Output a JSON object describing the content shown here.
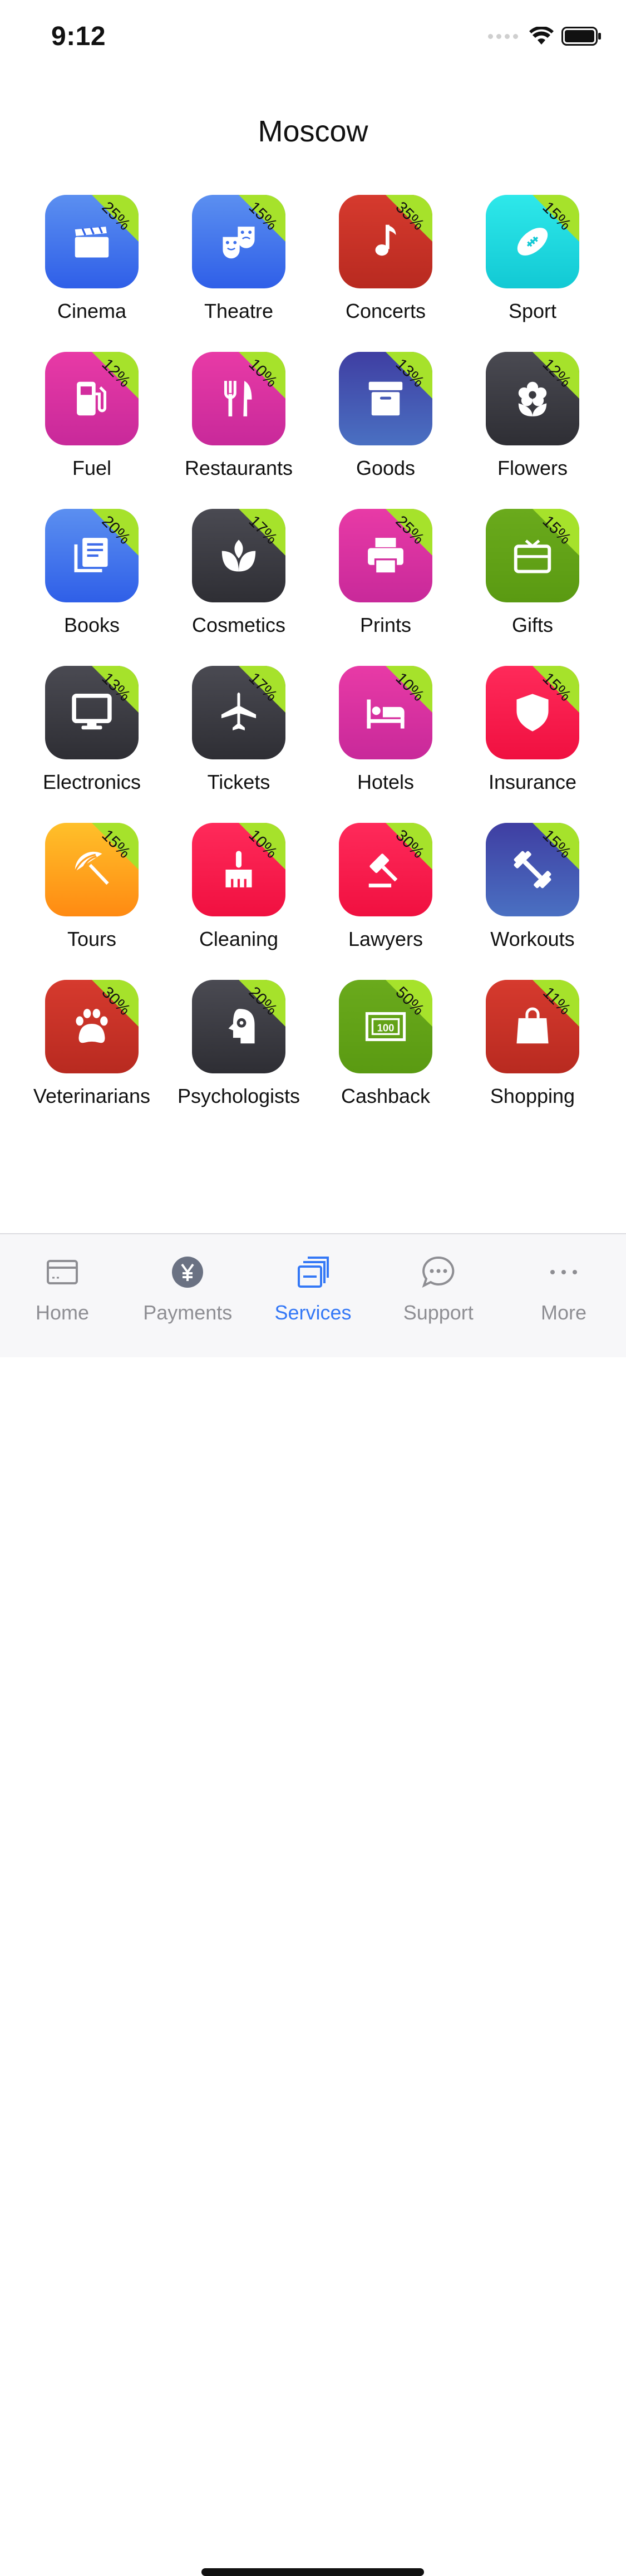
{
  "status": {
    "time": "9:12"
  },
  "page_title": "Moscow",
  "colors": {
    "accent": "#3478f6",
    "badge": "#a6e22b",
    "inactive": "#8e8e93"
  },
  "services": [
    {
      "key": "cinema",
      "label": "Cinema",
      "discount": "25%",
      "icon": "clapperboard-icon",
      "bg": "linear-gradient(180deg,#5b8ff0,#2f5fe8)"
    },
    {
      "key": "theatre",
      "label": "Theatre",
      "discount": "15%",
      "icon": "theatre-masks-icon",
      "bg": "linear-gradient(180deg,#5b8ff0,#2f5fe8)"
    },
    {
      "key": "concerts",
      "label": "Concerts",
      "discount": "35%",
      "icon": "music-note-icon",
      "bg": "linear-gradient(180deg,#d63a2e,#b82a20)"
    },
    {
      "key": "sport",
      "label": "Sport",
      "discount": "15%",
      "icon": "football-icon",
      "bg": "linear-gradient(180deg,#2ee8ea,#12c9d4)"
    },
    {
      "key": "fuel",
      "label": "Fuel",
      "discount": "12%",
      "icon": "fuel-pump-icon",
      "bg": "linear-gradient(180deg,#e83aa6,#c8299a)"
    },
    {
      "key": "restaurants",
      "label": "Restaurants",
      "discount": "10%",
      "icon": "fork-knife-icon",
      "bg": "linear-gradient(180deg,#e83aa6,#c8299a)"
    },
    {
      "key": "goods",
      "label": "Goods",
      "discount": "13%",
      "icon": "box-icon",
      "bg": "linear-gradient(180deg,#3f3ea2,#4a70c2)"
    },
    {
      "key": "flowers",
      "label": "Flowers",
      "discount": "12%",
      "icon": "flower-icon",
      "bg": "linear-gradient(180deg,#4a4a52,#2e2e34)"
    },
    {
      "key": "books",
      "label": "Books",
      "discount": "20%",
      "icon": "book-pages-icon",
      "bg": "linear-gradient(180deg,#5b8ff0,#2f5fe8)"
    },
    {
      "key": "cosmetics",
      "label": "Cosmetics",
      "discount": "17%",
      "icon": "lotus-icon",
      "bg": "linear-gradient(180deg,#4a4a52,#2e2e34)"
    },
    {
      "key": "prints",
      "label": "Prints",
      "discount": "25%",
      "icon": "printer-icon",
      "bg": "linear-gradient(180deg,#e83aa6,#c8299a)"
    },
    {
      "key": "gifts",
      "label": "Gifts",
      "discount": "15%",
      "icon": "gift-card-icon",
      "bg": "linear-gradient(180deg,#6aaa1c,#5a9a12)"
    },
    {
      "key": "electronics",
      "label": "Electronics",
      "discount": "13%",
      "icon": "monitor-icon",
      "bg": "linear-gradient(180deg,#4a4a52,#2e2e34)"
    },
    {
      "key": "tickets",
      "label": "Tickets",
      "discount": "17%",
      "icon": "airplane-icon",
      "bg": "linear-gradient(180deg,#4a4a52,#2e2e34)"
    },
    {
      "key": "hotels",
      "label": "Hotels",
      "discount": "10%",
      "icon": "bed-icon",
      "bg": "linear-gradient(180deg,#e83aa6,#c8299a)"
    },
    {
      "key": "insurance",
      "label": "Insurance",
      "discount": "15%",
      "icon": "shield-icon",
      "bg": "linear-gradient(180deg,#ff2a5a,#f01040)"
    },
    {
      "key": "tours",
      "label": "Tours",
      "discount": "15%",
      "icon": "beach-umbrella-icon",
      "bg": "linear-gradient(180deg,#ffc02a,#ff8a12)"
    },
    {
      "key": "cleaning",
      "label": "Cleaning",
      "discount": "10%",
      "icon": "broom-icon",
      "bg": "linear-gradient(180deg,#ff2a5a,#f01040)"
    },
    {
      "key": "lawyers",
      "label": "Lawyers",
      "discount": "30%",
      "icon": "gavel-icon",
      "bg": "linear-gradient(180deg,#ff2a5a,#f01040)"
    },
    {
      "key": "workouts",
      "label": "Workouts",
      "discount": "15%",
      "icon": "dumbbell-icon",
      "bg": "linear-gradient(180deg,#3f3ea2,#4a70c2)"
    },
    {
      "key": "veterinarians",
      "label": "Veterinarians",
      "discount": "30%",
      "icon": "paw-icon",
      "bg": "linear-gradient(180deg,#d63a2e,#b82a20)"
    },
    {
      "key": "psychologists",
      "label": "Psychologists",
      "discount": "20%",
      "icon": "head-gear-icon",
      "bg": "linear-gradient(180deg,#4a4a52,#2e2e34)"
    },
    {
      "key": "cashback",
      "label": "Cashback",
      "discount": "50%",
      "icon": "banknote-icon",
      "bg": "linear-gradient(180deg,#6aaa1c,#5a9a12)"
    },
    {
      "key": "shopping",
      "label": "Shopping",
      "discount": "11%",
      "icon": "shopping-bag-icon",
      "bg": "linear-gradient(180deg,#d63a2e,#b82a20)"
    }
  ],
  "tabs": [
    {
      "key": "home",
      "label": "Home",
      "icon": "card-icon",
      "active": false
    },
    {
      "key": "payments",
      "label": "Payments",
      "icon": "yen-coin-icon",
      "active": false
    },
    {
      "key": "services",
      "label": "Services",
      "icon": "stacked-cards-icon",
      "active": true
    },
    {
      "key": "support",
      "label": "Support",
      "icon": "chat-bubble-icon",
      "active": false
    },
    {
      "key": "more",
      "label": "More",
      "icon": "ellipsis-icon",
      "active": false
    }
  ]
}
